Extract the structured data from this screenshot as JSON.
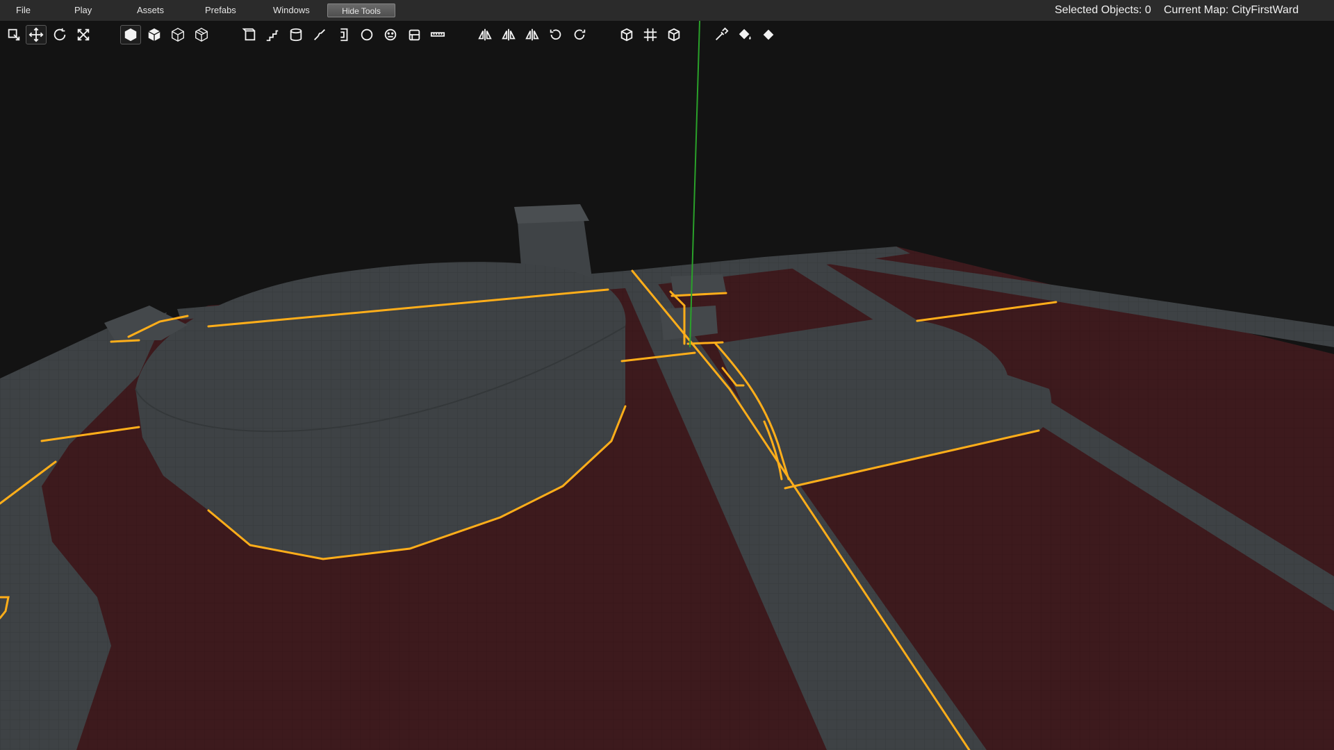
{
  "menu": {
    "file": "File",
    "play": "Play",
    "assets": "Assets",
    "prefabs": "Prefabs",
    "windows": "Windows",
    "hide_tools": "Hide Tools"
  },
  "status": {
    "selected_objects": "Selected Objects: 0",
    "current_map": "Current Map: CityFirstWard"
  },
  "tools": [
    "select-tool-icon",
    "move-tool-icon",
    "rotate-tool-icon",
    "scale-tool-icon",
    "solid-view-icon",
    "shaded-view-icon",
    "wireframe-view-icon",
    "wire-shaded-view-icon",
    "box-brush-icon",
    "stairs-brush-icon",
    "cylinder-brush-icon",
    "arch-brush-icon",
    "door-brush-icon",
    "sphere-brush-icon",
    "entity-face-icon",
    "texture-brush-icon",
    "measure-icon",
    "mirror-x-icon",
    "mirror-y-icon",
    "mirror-z-icon",
    "rotate-ccw-icon",
    "rotate-cw-icon",
    "cube-icon",
    "grid-icon",
    "cube-outline-icon",
    "eyedropper-icon",
    "paint-bucket-icon",
    "fill-icon"
  ],
  "colors": {
    "background": "#131313",
    "ground": "#3d1a1d",
    "concrete": "#3e4245",
    "highlight": "#ffae1a",
    "axis": "#2aa12a"
  }
}
